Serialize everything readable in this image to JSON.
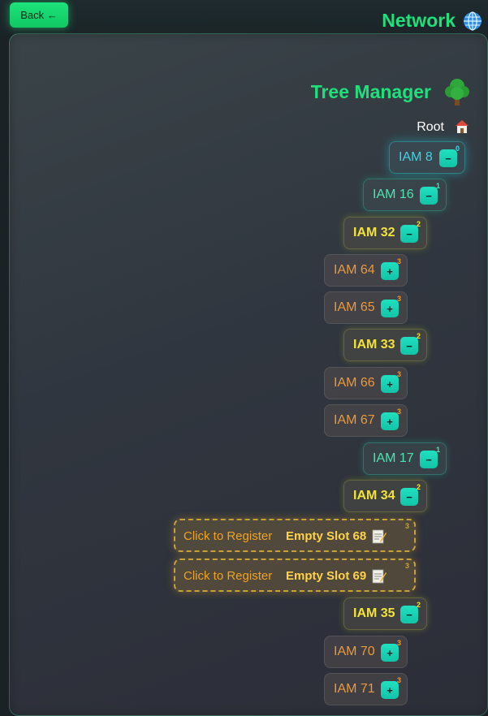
{
  "header": {
    "back_label": "Back ←",
    "title": "Network",
    "title_icon": "globe-icon"
  },
  "tree": {
    "title": "Tree Manager",
    "title_icon": "tree-icon",
    "root_label": "Root",
    "root_icon": "house-icon"
  },
  "nodes": [
    {
      "label": "IAM 8",
      "level": "0",
      "toggle": "−"
    },
    {
      "label": "IAM 16",
      "level": "1",
      "toggle": "−"
    },
    {
      "label": "IAM 32",
      "level": "2",
      "toggle": "−"
    },
    {
      "label": "IAM 64",
      "level": "3",
      "toggle": "+"
    },
    {
      "label": "IAM 65",
      "level": "3",
      "toggle": "+"
    },
    {
      "label": "IAM 33",
      "level": "2",
      "toggle": "−"
    },
    {
      "label": "IAM 66",
      "level": "3",
      "toggle": "+"
    },
    {
      "label": "IAM 67",
      "level": "3",
      "toggle": "+"
    },
    {
      "label": "IAM 17",
      "level": "1",
      "toggle": "−"
    },
    {
      "label": "IAM 34",
      "level": "2",
      "toggle": "−"
    },
    {
      "label": "IAM 35",
      "level": "2",
      "toggle": "−"
    },
    {
      "label": "IAM 70",
      "level": "3",
      "toggle": "+"
    },
    {
      "label": "IAM 71",
      "level": "3",
      "toggle": "+"
    }
  ],
  "slots": [
    {
      "cta": "Click to Register",
      "name": "Empty Slot 68",
      "level": "3",
      "icon": "memo-icon"
    },
    {
      "cta": "Click to Register",
      "name": "Empty Slot 69",
      "level": "3",
      "icon": "memo-icon"
    }
  ],
  "colors": {
    "accent_green": "#1fe07a",
    "toggle_teal": "#20e0c0",
    "level0_text": "#3fd6e0",
    "level1_text": "#4ee3b0",
    "level2_text": "#f2e23a",
    "level3_text": "#e89a3c",
    "slot_border": "#c9a13a"
  }
}
